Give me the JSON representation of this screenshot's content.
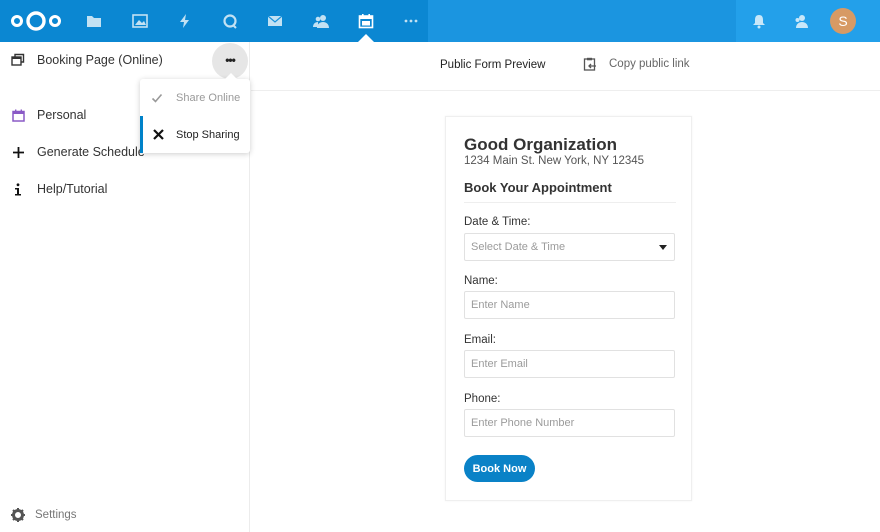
{
  "header": {
    "apps": [
      {
        "name": "files",
        "icon": "folder-icon"
      },
      {
        "name": "photos",
        "icon": "image-icon"
      },
      {
        "name": "activity",
        "icon": "lightning-icon"
      },
      {
        "name": "talk",
        "icon": "talk-icon"
      },
      {
        "name": "mail",
        "icon": "mail-icon"
      },
      {
        "name": "contacts",
        "icon": "contacts-icon"
      },
      {
        "name": "appointments",
        "icon": "calendar-icon",
        "active": true
      },
      {
        "name": "more-apps",
        "icon": "more-horizontal-icon"
      }
    ],
    "avatar_initial": "S",
    "avatar_color": "#d79a64",
    "brand_color": "#0b87d2"
  },
  "sidebar": {
    "page_item": {
      "label": "Booking Page (Online)"
    },
    "items": [
      {
        "label": "Personal",
        "icon": "calendar-icon"
      },
      {
        "label": "Generate Schedule",
        "icon": "plus-icon"
      },
      {
        "label": "Help/Tutorial",
        "icon": "info-icon"
      }
    ],
    "settings_label": "Settings",
    "menu": [
      {
        "label": "Share Online",
        "icon": "check-icon",
        "disabled": true
      },
      {
        "label": "Stop Sharing",
        "icon": "close-icon",
        "active": true
      }
    ]
  },
  "main": {
    "preview_tab": "Public Form Preview",
    "copy_link_label": "Copy public link",
    "form": {
      "org_name": "Good Organization",
      "org_address": "1234 Main St. New York, NY 12345",
      "title": "Book Your Appointment",
      "fields": {
        "datetime": {
          "label": "Date & Time:",
          "placeholder": "Select Date & Time"
        },
        "name": {
          "label": "Name:",
          "placeholder": "Enter Name"
        },
        "email": {
          "label": "Email:",
          "placeholder": "Enter Email"
        },
        "phone": {
          "label": "Phone:",
          "placeholder": "Enter Phone Number"
        }
      },
      "submit_label": "Book Now",
      "button_color": "#0a82c7"
    }
  }
}
